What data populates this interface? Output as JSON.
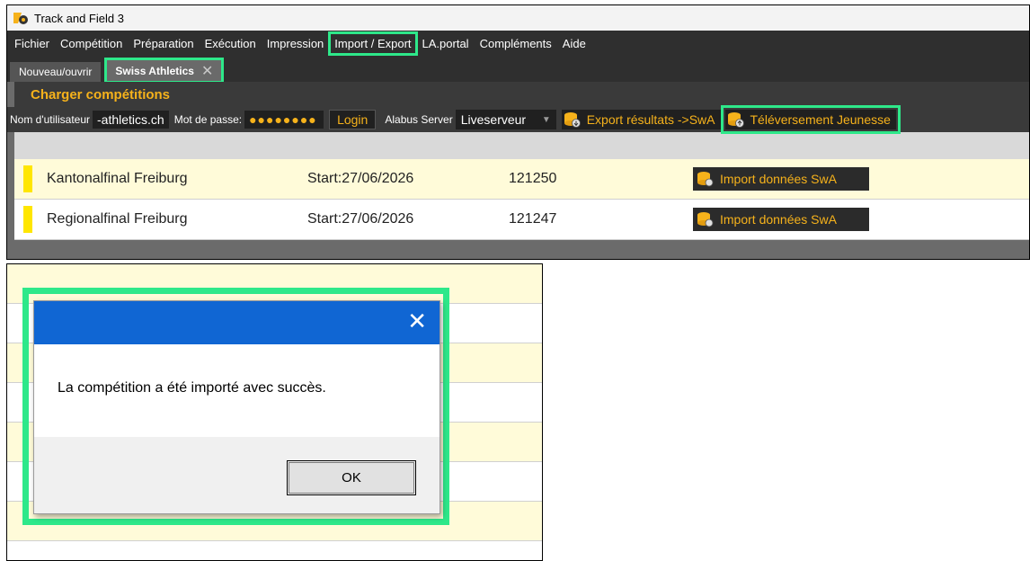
{
  "window": {
    "title": "Track and Field 3"
  },
  "menu": {
    "items": [
      "Fichier",
      "Compétition",
      "Préparation",
      "Exécution",
      "Impression",
      "Import / Export",
      "LA.portal",
      "Compléments",
      "Aide"
    ],
    "highlighted": "Import / Export"
  },
  "tabs": [
    {
      "label": "Nouveau/ouvrir",
      "active": false
    },
    {
      "label": "Swiss Athletics",
      "active": true,
      "close_icon": "close-icon"
    }
  ],
  "panel": {
    "header": "Charger compétitions",
    "username_label": "Nom d'utilisateur",
    "username_value": "-athletics.ch",
    "password_label": "Mot de passe:",
    "password_value": "●●●●●●●●",
    "login_button": "Login",
    "server_label": "Alabus Server",
    "server_value": "Liveserveur",
    "export_button": "Export résultats ->SwA",
    "upload_button": "Téléversement Jeunesse"
  },
  "competitions": [
    {
      "name": "Kantonalfinal Freiburg",
      "start": "Start:27/06/2026",
      "id": "121250",
      "action": "Import données SwA"
    },
    {
      "name": "Regionalfinal Freiburg",
      "start": "Start:27/06/2026",
      "id": "121247",
      "action": "Import données SwA"
    }
  ],
  "dialog": {
    "message": "La compétition a été importé avec succès.",
    "ok_button": "OK",
    "close_icon": "close-icon"
  },
  "colors": {
    "accent": "#f6b21b",
    "highlight": "#2ee88a",
    "dialog_titlebar": "#1066d3",
    "menu_bg": "#2f2f2f",
    "row_yellow": "#fffbd9",
    "marker": "#ffe600"
  }
}
